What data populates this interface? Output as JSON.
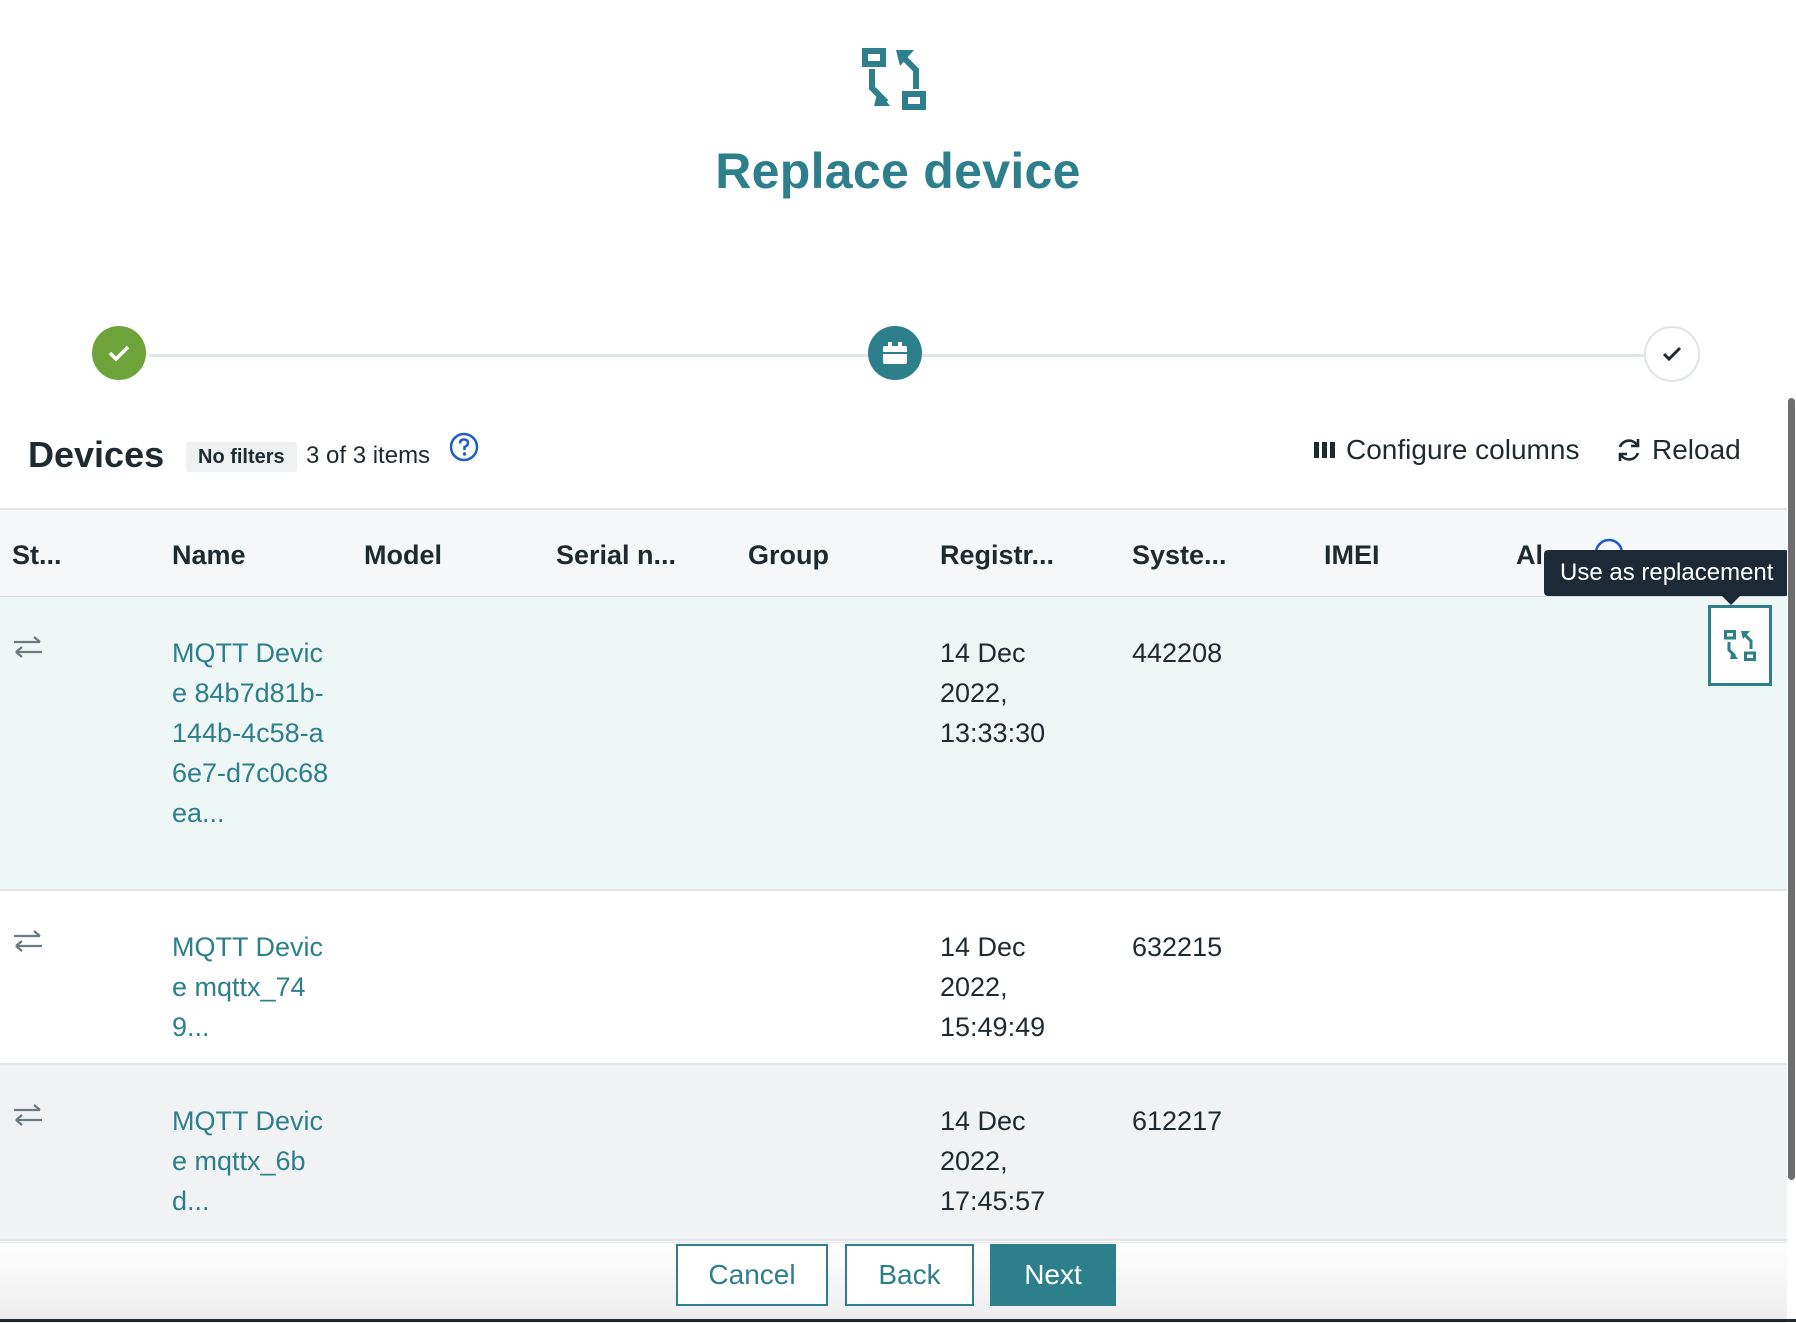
{
  "header": {
    "title": "Replace device",
    "icon": "replace-device-icon",
    "steps": [
      {
        "state": "completed",
        "icon": "check-icon",
        "color": "#6ea33a"
      },
      {
        "state": "active",
        "icon": "device-icon",
        "color": "#2d7f8b"
      },
      {
        "state": "pending",
        "icon": "check-icon"
      }
    ]
  },
  "devices": {
    "title": "Devices",
    "filter_badge": "No filters",
    "count_text": "3 of 3 items",
    "configure_columns_label": "Configure columns",
    "reload_label": "Reload",
    "columns": [
      "St...",
      "Name",
      "Model",
      "Serial n...",
      "Group",
      "Registr...",
      "Syste...",
      "IMEI",
      "Al"
    ],
    "rows": [
      {
        "status_icon": "connection-arrows-icon",
        "name": "MQTT Device 84b7d81b-144b-4c58-a6e7-d7c0c68ea...",
        "registration": "14 Dec 2022, 13:33:30",
        "system_id": "442208"
      },
      {
        "status_icon": "connection-arrows-icon",
        "name": "MQTT Device mqttx_749...",
        "registration": "14 Dec 2022, 15:49:49",
        "system_id": "632215"
      },
      {
        "status_icon": "connection-arrows-icon",
        "name": "MQTT Device mqttx_6bd...",
        "registration": "14 Dec 2022, 17:45:57",
        "system_id": "612217"
      }
    ],
    "tooltip": "Use as replacement"
  },
  "footer": {
    "cancel_label": "Cancel",
    "back_label": "Back",
    "next_label": "Next"
  },
  "colors": {
    "accent": "#2d7f8b",
    "success": "#6ea33a",
    "tooltip": "#1c2a38"
  }
}
